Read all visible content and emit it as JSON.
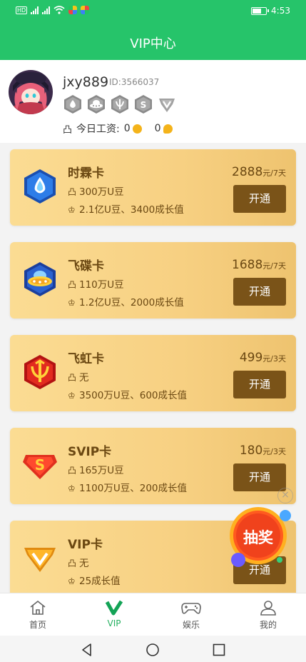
{
  "status_bar": {
    "time": "4:53",
    "hd_label": "HD"
  },
  "header": {
    "title": "VIP中心"
  },
  "profile": {
    "username": "jxy889",
    "user_id": "ID:3566037",
    "badges": [
      "water-drop-badge",
      "ufo-badge",
      "rainbow-badge",
      "svip-badge",
      "vip-badge"
    ],
    "wage_label": "今日工资:",
    "wage_value_1": "0",
    "wage_value_2": "0"
  },
  "cards": [
    {
      "name": "时霖卡",
      "benefit1": "300万U豆",
      "benefit2": "2.1亿U豆、3400成长值",
      "price": "2888",
      "unit": "元/7天",
      "button": "开通",
      "icon": "water-drop-icon"
    },
    {
      "name": "飞碟卡",
      "benefit1": "110万U豆",
      "benefit2": "1.2亿U豆、2000成长值",
      "price": "1688",
      "unit": "元/7天",
      "button": "开通",
      "icon": "ufo-icon"
    },
    {
      "name": "飞虹卡",
      "benefit1": "无",
      "benefit2": "3500万U豆、600成长值",
      "price": "499",
      "unit": "元/3天",
      "button": "开通",
      "icon": "rainbow-icon"
    },
    {
      "name": "SVIP卡",
      "benefit1": "165万U豆",
      "benefit2": "1100万U豆、200成长值",
      "price": "180",
      "unit": "元/3天",
      "button": "开通",
      "icon": "svip-icon"
    },
    {
      "name": "VIP卡",
      "benefit1": "无",
      "benefit2": "25成长值",
      "price": "",
      "unit": "",
      "button": "开通",
      "icon": "vip-icon"
    }
  ],
  "floating": {
    "lottery_label": "抽奖",
    "close": "×"
  },
  "bottom_nav": [
    {
      "label": "首页",
      "icon": "home-icon"
    },
    {
      "label": "VIP",
      "icon": "vip-icon"
    },
    {
      "label": "娱乐",
      "icon": "gamepad-icon"
    },
    {
      "label": "我的",
      "icon": "user-icon"
    }
  ],
  "colors": {
    "brand_green": "#26c46a",
    "card_brown": "#7a5318",
    "card_gold": "#f7d082"
  }
}
